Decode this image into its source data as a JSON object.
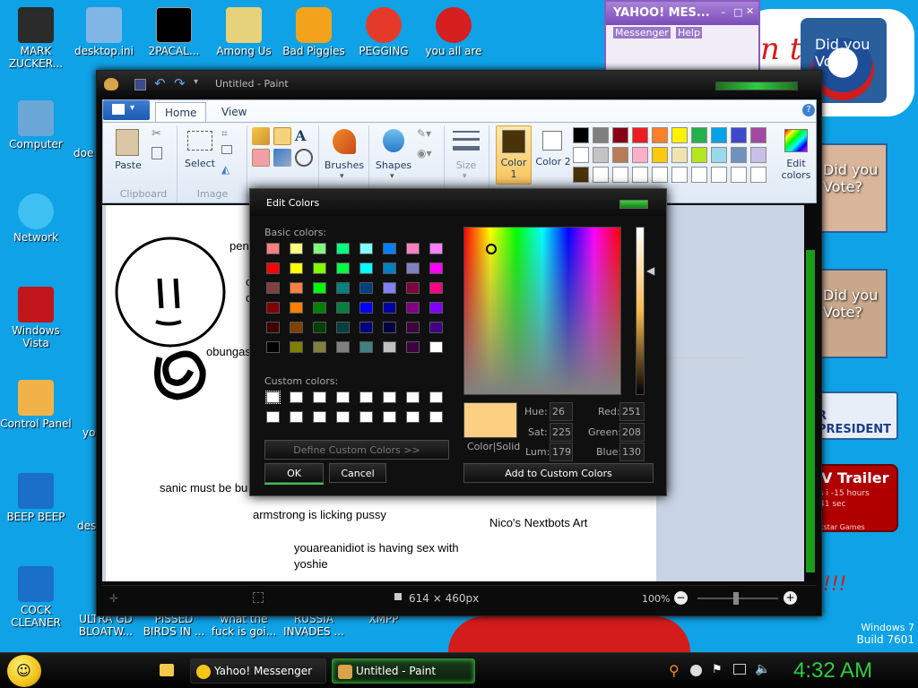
{
  "desktop": {
    "icons_top": [
      {
        "label": "MARK ZUCKER...",
        "icon": "person-icon"
      },
      {
        "label": "desktop.ini",
        "icon": "file-icon"
      },
      {
        "label": "2PACAL...",
        "icon": "cmd-icon"
      },
      {
        "label": "Among Us",
        "icon": "app-icon"
      },
      {
        "label": "Bad Piggies",
        "icon": "game-icon"
      },
      {
        "label": "PEGGING",
        "icon": "p-icon"
      },
      {
        "label": "you all are",
        "icon": "devcpp-icon"
      }
    ],
    "icons_left": [
      {
        "label": "Computer",
        "icon": "computer-icon"
      },
      {
        "label": "Network",
        "icon": "network-icon"
      },
      {
        "label": "Windows Vista",
        "icon": "recycle-bin-icon"
      },
      {
        "label": "Control Panel",
        "icon": "control-panel-icon"
      },
      {
        "label": "BEEP BEEP",
        "icon": "file-icon"
      },
      {
        "label": "COCK CLEANER",
        "icon": "file-icon"
      }
    ],
    "partial_labels": {
      "doe": "doe",
      "yo": "yo",
      "des": "des"
    },
    "icons_bottom": [
      {
        "label": "ULTRA GD BLOATW..."
      },
      {
        "label": "PISSED BIRDS IN ..."
      },
      {
        "label": "what the fuck is goi..."
      },
      {
        "label": "RUSSIA INVADES ..."
      },
      {
        "label": "XMPP"
      }
    ],
    "watermark": {
      "line1": "Windows 7",
      "line2": "Build 7601"
    },
    "ads": {
      "did_you_vote_1": "Did you Vote?",
      "did_you_vote_2": "Did you Vote?",
      "did_you_vote_3": "Did you Vote?",
      "president": "R PRESIDENT",
      "trailer": "V Trailer",
      "trailer_sub1": "s i -15 hours",
      "trailer_sub2": "41 sec",
      "trailer_sub3": "kstar Games"
    }
  },
  "yahoo": {
    "title": "YAHOO! MES...",
    "menu": [
      "Messenger",
      "Help"
    ]
  },
  "paint": {
    "title": "Untitled - Paint",
    "tabs": [
      "Home",
      "View"
    ],
    "groups": {
      "clipboard": "Clipboard",
      "image": "Image",
      "paste": "Paste",
      "select": "Select",
      "brushes": "Brushes",
      "shapes": "Shapes",
      "size": "Size",
      "color1": "Color 1",
      "color2": "Color 2",
      "edit_colors": "Edit colors"
    },
    "color1_value": "#4a3308",
    "color2_value": "#ffffff",
    "palette_row1": [
      "#000000",
      "#7f7f7f",
      "#880015",
      "#ed1c24",
      "#ff7f27",
      "#fff200",
      "#22b14c",
      "#00a2e8",
      "#3f48cc",
      "#a349a4"
    ],
    "palette_row2": [
      "#ffffff",
      "#c3c3c3",
      "#b97a57",
      "#ffaec9",
      "#ffc90e",
      "#efe4b0",
      "#b5e61d",
      "#99d9ea",
      "#7092be",
      "#c8bfe7"
    ],
    "palette_row3": [
      "#4a3308",
      "#ffffff",
      "#ffffff",
      "#ffffff",
      "#ffffff",
      "#ffffff",
      "#ffffff",
      "#ffffff",
      "#ffffff",
      "#ffffff"
    ],
    "canvas_texts": {
      "pen": "pen",
      "c1": "c",
      "c2": "c",
      "obungas": "obungas",
      "sanic": "sanic must be bu",
      "armstrong": "armstrong is licking pussy",
      "nicos": "Nico's Nextbots Art",
      "youareanidiot": "youareanidiot is having sex with yoshie"
    },
    "status": {
      "size": "614 × 460px",
      "zoom": "100%"
    }
  },
  "edit_colors": {
    "title": "Edit Colors",
    "basic_label": "Basic colors:",
    "custom_label": "Custom colors:",
    "basic_colors": [
      "#ff8080",
      "#ffff80",
      "#80ff80",
      "#00ff80",
      "#80ffff",
      "#0080ff",
      "#ff80c0",
      "#ff80ff",
      "#ff0000",
      "#ffff00",
      "#80ff00",
      "#00ff40",
      "#00ffff",
      "#0080c0",
      "#8080c0",
      "#ff00ff",
      "#804040",
      "#ff8040",
      "#00ff00",
      "#008080",
      "#004080",
      "#8080ff",
      "#800040",
      "#ff0080",
      "#800000",
      "#ff8000",
      "#008000",
      "#008040",
      "#0000ff",
      "#0000a0",
      "#800080",
      "#8000ff",
      "#400000",
      "#804000",
      "#004000",
      "#004040",
      "#000080",
      "#000040",
      "#400040",
      "#400080",
      "#000000",
      "#808000",
      "#808040",
      "#808080",
      "#408080",
      "#c0c0c0",
      "#400040",
      "#ffffff"
    ],
    "define_custom": "Define Custom Colors >>",
    "ok": "OK",
    "cancel": "Cancel",
    "add_custom": "Add to Custom Colors",
    "color_solid": "Color|Solid",
    "preview_color": "#fbd082",
    "fields": {
      "hue_label": "Hue:",
      "hue": "26",
      "sat_label": "Sat:",
      "sat": "225",
      "lum_label": "Lum:",
      "lum": "179",
      "red_label": "Red:",
      "red": "251",
      "green_label": "Green:",
      "green": "208",
      "blue_label": "Blue:",
      "blue": "130"
    }
  },
  "taskbar": {
    "items": [
      {
        "label": "Yahoo! Messenger"
      },
      {
        "label": "Untitled - Paint"
      }
    ],
    "clock": "4:32 AM"
  }
}
